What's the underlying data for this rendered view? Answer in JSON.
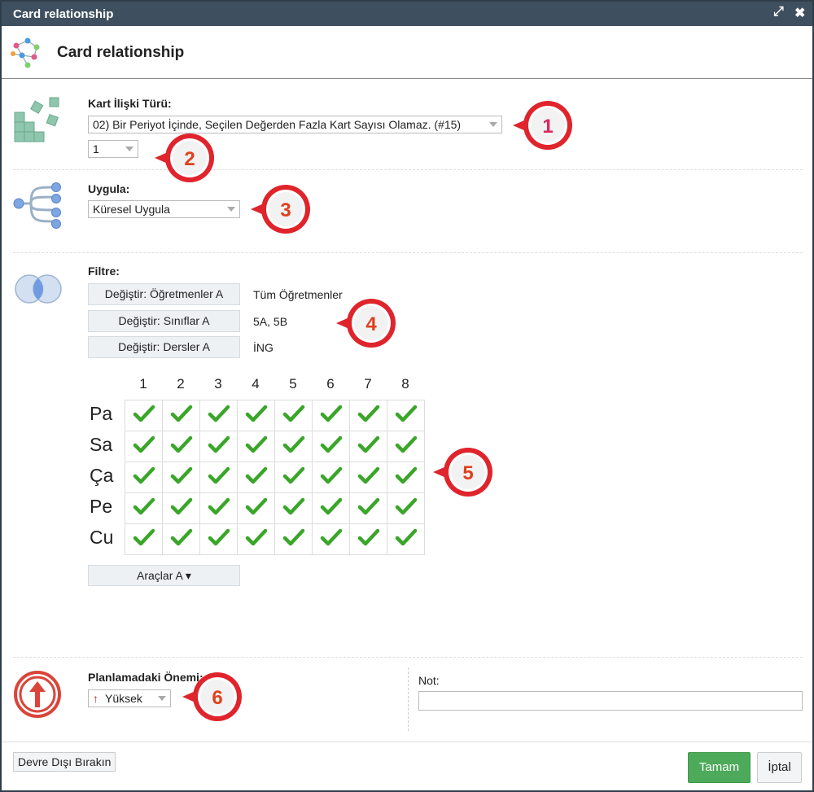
{
  "window": {
    "title": "Card relationship"
  },
  "header": {
    "title": "Card relationship",
    "icon": "network-graph-icon"
  },
  "relation_type": {
    "label": "Kart İlişki Türü:",
    "value": "02) Bir Periyot İçinde, Seçilen Değerden Fazla Kart Sayısı Olamaz. (#15)",
    "count_value": "1"
  },
  "apply": {
    "label": "Uygula:",
    "value": "Küresel Uygula"
  },
  "filter": {
    "label": "Filtre:",
    "rows": [
      {
        "button": "Değiştir: Öğretmenler A",
        "value": "Tüm Öğretmenler"
      },
      {
        "button": "Değiştir: Sınıflar A",
        "value": "5A, 5B"
      },
      {
        "button": "Değiştir: Dersler A",
        "value": "İNG"
      }
    ]
  },
  "grid": {
    "columns": [
      "1",
      "2",
      "3",
      "4",
      "5",
      "6",
      "7",
      "8"
    ],
    "rows": [
      "Pa",
      "Sa",
      "Ça",
      "Pe",
      "Cu"
    ],
    "all_checked": true,
    "check_color": "#3aa629"
  },
  "tools": {
    "label": "Araçlar A ▾"
  },
  "importance": {
    "label": "Planlamadaki Önemi:",
    "value": "Yüksek",
    "icon": "arrow-up-icon",
    "accent": "#d9453a"
  },
  "note": {
    "label": "Not:",
    "value": ""
  },
  "footer": {
    "disable_label": "Devre Dışı Bırakın",
    "ok_label": "Tamam",
    "cancel_label": "İptal"
  },
  "callouts": [
    "1",
    "2",
    "3",
    "4",
    "5",
    "6"
  ],
  "colors": {
    "titlebar": "#3e4f5f",
    "ok": "#4caa5a",
    "callout_ring": "#e0242c"
  }
}
